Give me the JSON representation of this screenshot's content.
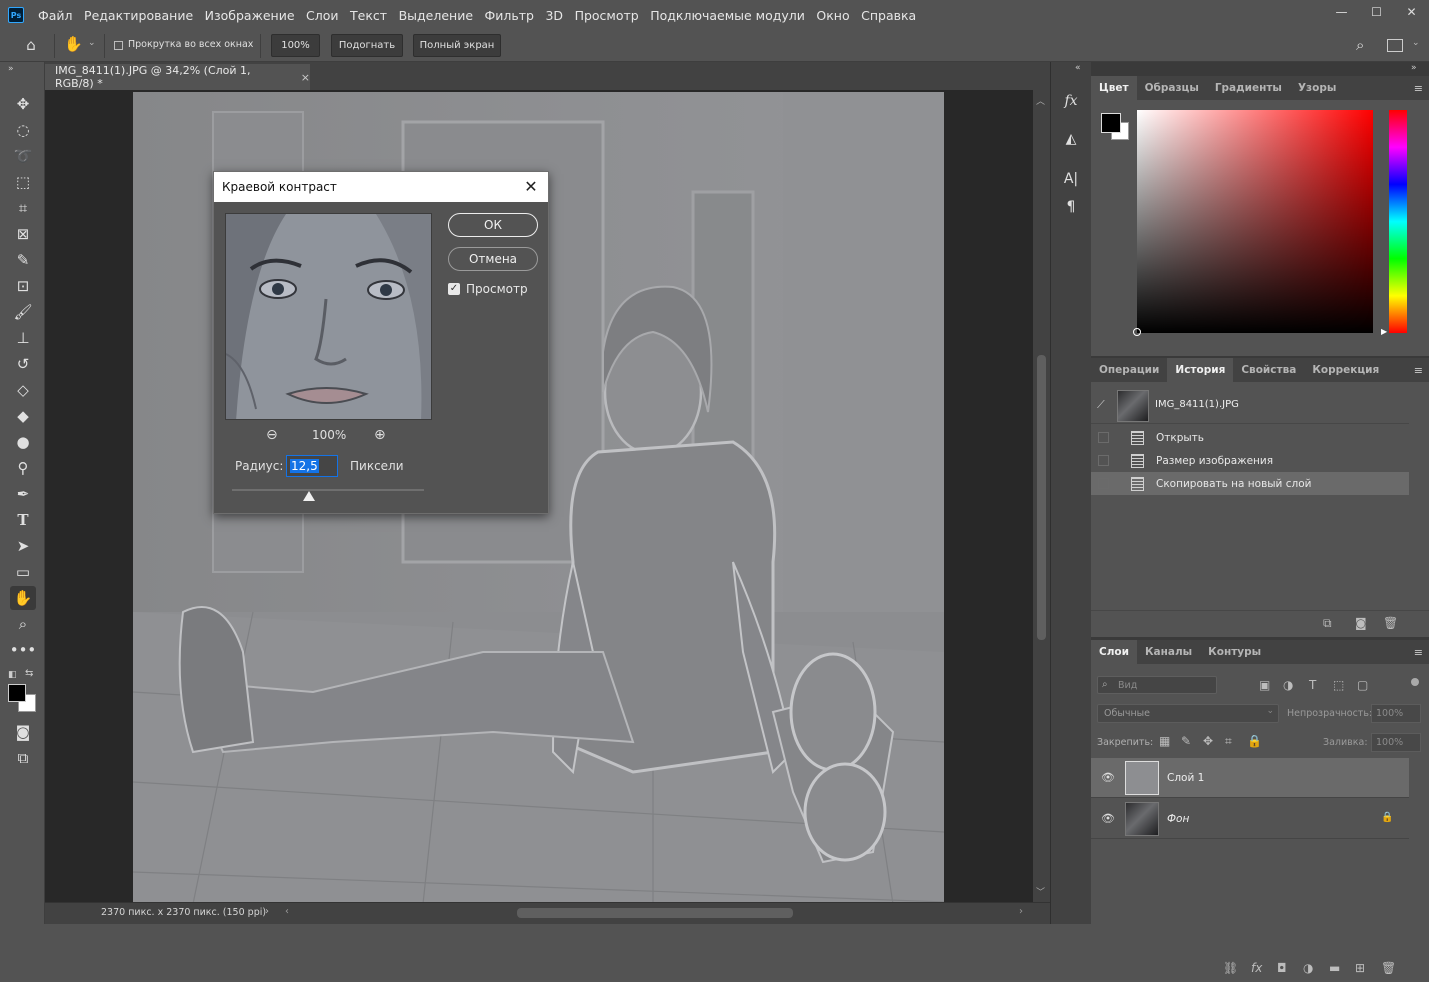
{
  "app": {
    "logo": "Ps"
  },
  "menubar": {
    "items": [
      "Файл",
      "Редактирование",
      "Изображение",
      "Слои",
      "Текст",
      "Выделение",
      "Фильтр",
      "3D",
      "Просмотр",
      "Подключаемые модули",
      "Окно",
      "Справка"
    ]
  },
  "options": {
    "scroll_all_label": "Прокрутка во всех окнах",
    "zoom_value": "100%",
    "fit_label": "Подогнать",
    "fullscreen_label": "Полный экран"
  },
  "document": {
    "tab_title": "IMG_8411(1).JPG @ 34,2% (Слой 1, RGB/8) *",
    "status": "2370 пикс. x 2370 пикс. (150 ppi)"
  },
  "dialog": {
    "title": "Краевой контраст",
    "ok_label": "ОК",
    "cancel_label": "Отмена",
    "preview_label": "Просмотр",
    "preview_checked": true,
    "zoom_value": "100%",
    "radius_label": "Радиус:",
    "radius_value": "12,5",
    "radius_unit": "Пиксели",
    "radius_slider_fraction": 0.4
  },
  "color_panel": {
    "tabs": [
      "Цвет",
      "Образцы",
      "Градиенты",
      "Узоры"
    ],
    "active_tab": "Цвет",
    "foreground_color": "#000000",
    "background_color": "#ffffff",
    "hue_color": "#ff0000"
  },
  "history_panel": {
    "tabs": [
      "Операции",
      "История",
      "Свойства",
      "Коррекция"
    ],
    "active_tab": "История",
    "snapshot_name": "IMG_8411(1).JPG",
    "steps": [
      "Открыть",
      "Размер изображения",
      "Скопировать на новый слой"
    ],
    "active_step": "Скопировать на новый слой"
  },
  "layers_panel": {
    "tabs": [
      "Слои",
      "Каналы",
      "Контуры"
    ],
    "active_tab": "Слои",
    "filter_placeholder": "Вид",
    "blend_mode": "Обычные",
    "opacity_label": "Непрозрачность:",
    "opacity_value": "100%",
    "lock_label": "Закрепить:",
    "fill_label": "Заливка:",
    "fill_value": "100%",
    "layers": [
      {
        "name": "Слой 1",
        "visible": true,
        "locked": false,
        "selected": true
      },
      {
        "name": "Фон",
        "visible": true,
        "locked": true,
        "selected": false
      }
    ]
  },
  "colors": {
    "menu_bg": "#535353",
    "panel_bg": "#535353",
    "dark_bg": "#282828",
    "selection_bg": "#6a6a6a",
    "accent": "#1473e6"
  }
}
